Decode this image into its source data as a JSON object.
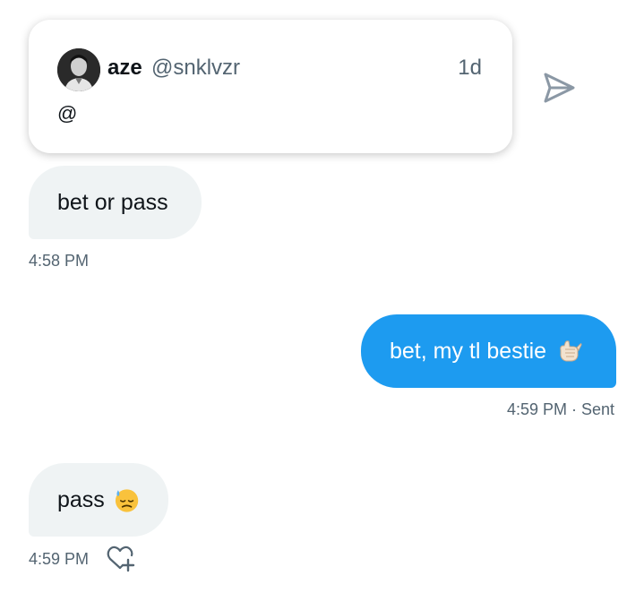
{
  "quoted_tweet": {
    "author_name": "aze",
    "author_handle": "@snklvzr",
    "time_ago": "1d",
    "text": "@",
    "avatar_icon": "profile-photo"
  },
  "share_icon": "send-arrow-icon",
  "messages": [
    {
      "direction": "received",
      "text": "bet or pass",
      "timestamp": "4:58 PM"
    },
    {
      "direction": "sent",
      "text": "bet, my tl bestie",
      "emoji": "call-me-hand",
      "timestamp": "4:59 PM · Sent"
    },
    {
      "direction": "received",
      "text": "pass",
      "emoji": "downcast-face-with-sweat",
      "timestamp": "4:59 PM",
      "reaction_icon": "heart-plus-icon"
    }
  ],
  "colors": {
    "sent_bubble": "#1d9bf0",
    "received_bubble": "#eff3f4",
    "secondary_text": "#536471"
  }
}
